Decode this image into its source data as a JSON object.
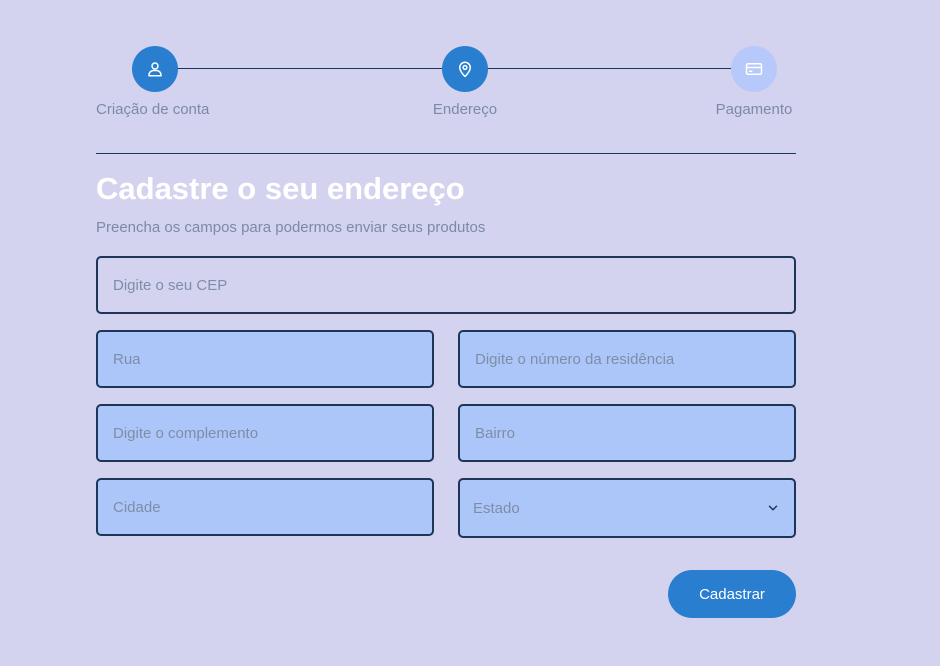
{
  "stepper": {
    "steps": [
      {
        "label": "Criação de conta",
        "icon": "user-icon",
        "state": "active"
      },
      {
        "label": "Endereço",
        "icon": "map-pin-icon",
        "state": "active"
      },
      {
        "label": "Pagamento",
        "icon": "credit-card-icon",
        "state": "pending"
      }
    ]
  },
  "form": {
    "title": "Cadastre o seu endereço",
    "subtitle": "Preencha os campos para podermos enviar seus produtos",
    "cep_placeholder": "Digite o seu CEP",
    "rua_placeholder": "Rua",
    "numero_placeholder": "Digite o número da residência",
    "complemento_placeholder": "Digite o complemento",
    "bairro_placeholder": "Bairro",
    "cidade_placeholder": "Cidade",
    "estado_selected": "Estado",
    "submit_label": "Cadastrar"
  },
  "colors": {
    "background": "#d4d3ef",
    "accent": "#2a7ed0",
    "pending_step": "#b7c9fb",
    "field_fill": "#adc6fa",
    "border": "#1d3557"
  }
}
